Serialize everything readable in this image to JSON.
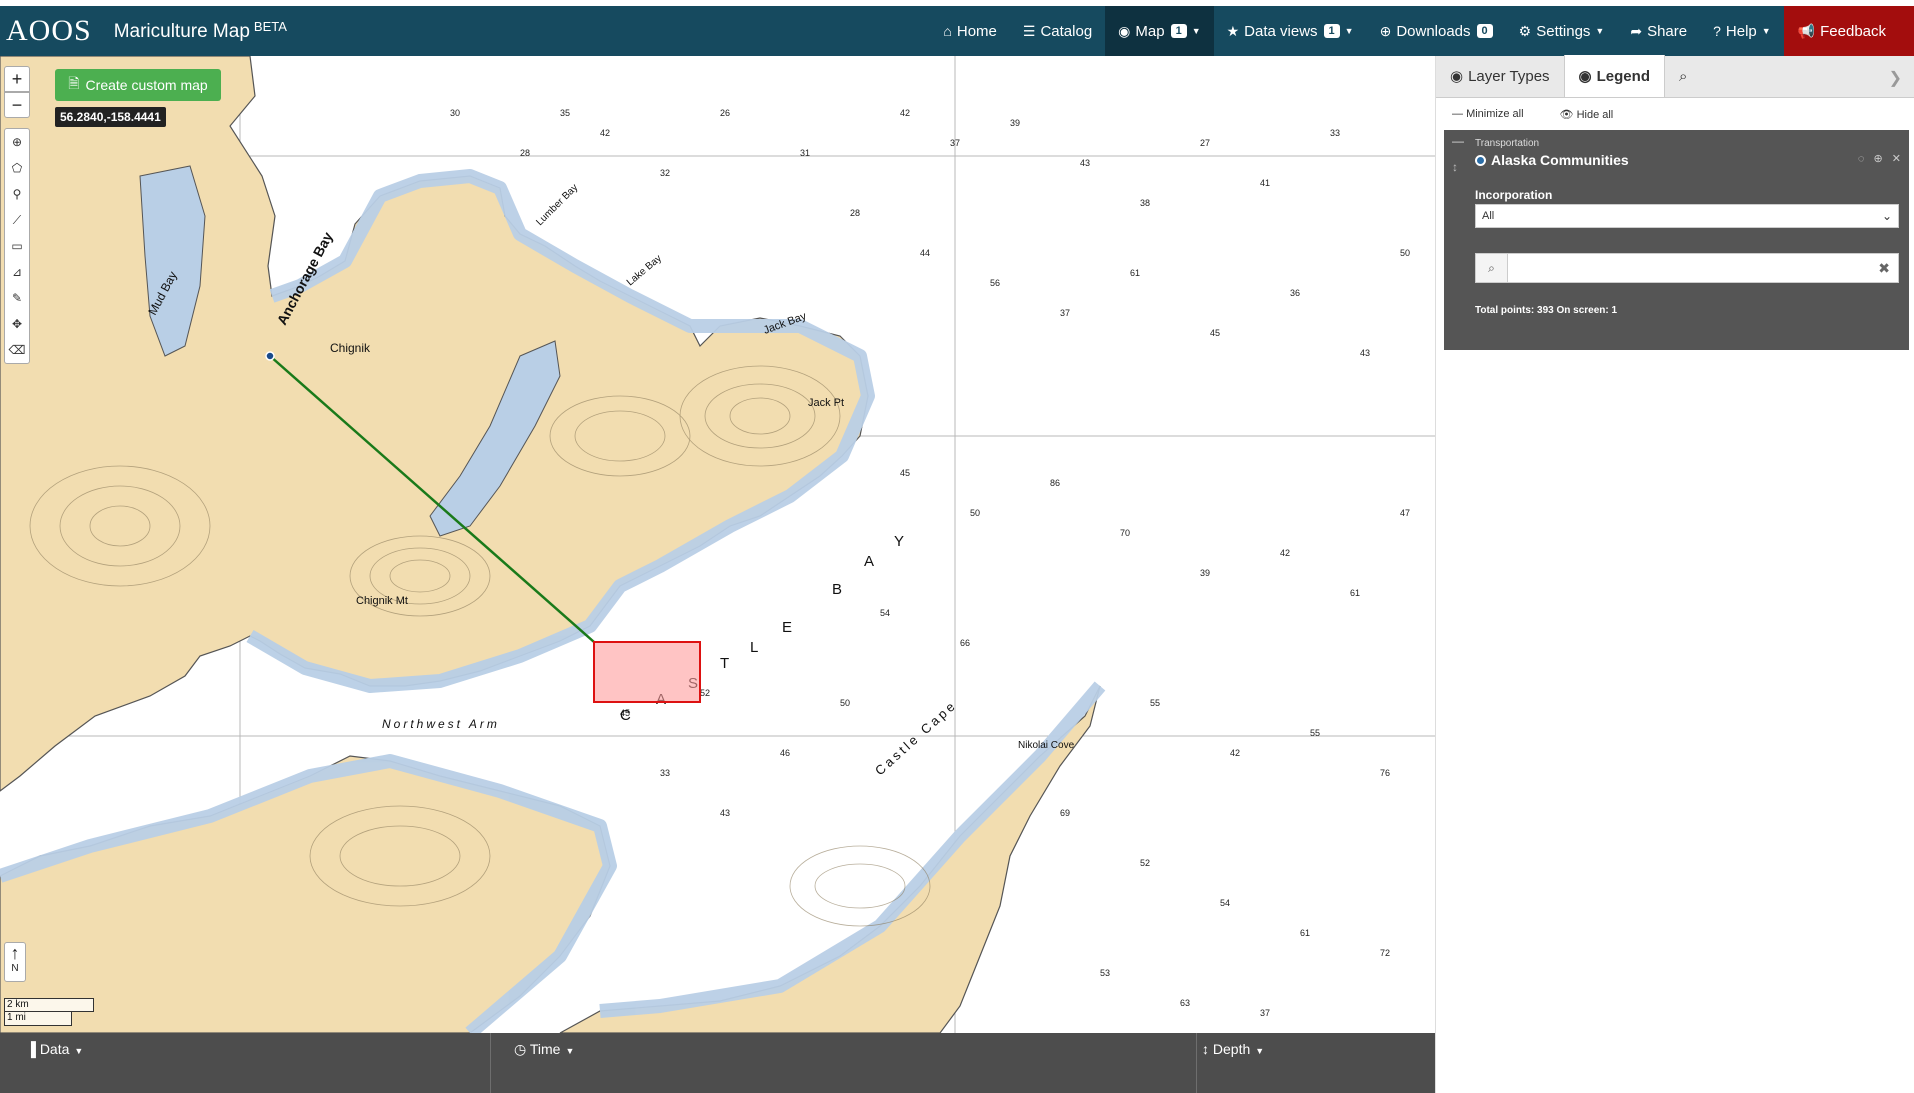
{
  "app": {
    "logo": "AOOS",
    "title": "Mariculture Map",
    "title_badge": "BETA"
  },
  "nav": {
    "home": "Home",
    "catalog": "Catalog",
    "map": "Map",
    "map_count": "1",
    "data_views": "Data views",
    "data_views_count": "1",
    "downloads": "Downloads",
    "downloads_count": "0",
    "settings": "Settings",
    "share": "Share",
    "help": "Help",
    "feedback": "Feedback"
  },
  "map": {
    "create_custom_map": "Create custom map",
    "coordinates": "56.2840,-158.4441",
    "north_label": "N",
    "scale_km": "2 km",
    "scale_mi": "1 mi",
    "chart_labels": {
      "anchorage_bay": "Anchorage Bay",
      "mud_bay": "Mud Bay",
      "chignik": "Chignik",
      "chignik_mt": "Chignik Mt",
      "jack_bay": "Jack Bay",
      "jack_pt": "Jack Pt",
      "lake_bay": "Lake Bay",
      "lumber_bay": "Lumber Bay",
      "northwest_arm": "Northwest Arm",
      "castle_cape": "Castle Cape",
      "nikolai_cove": "Nikolai Cove",
      "castle_bay_letters": [
        "C",
        "A",
        "S",
        "T",
        "L",
        "E",
        "B",
        "A",
        "Y"
      ]
    }
  },
  "bottom": {
    "data": "Data",
    "time": "Time",
    "depth": "Depth"
  },
  "sidebar": {
    "tabs": [
      "Layer Types",
      "Legend"
    ],
    "minimize_all": "Minimize all",
    "hide_all": "Hide all",
    "layer": {
      "category": "Transportation",
      "name": "Alaska Communities",
      "filter_label": "Incorporation",
      "filter_value": "All",
      "search_placeholder": "",
      "total": "Total points: 393 On screen: 1"
    }
  },
  "colors": {
    "navbar": "#164a5f",
    "feedback": "#a30d0d",
    "land": "#f2ddb0",
    "shallow_water": "#b9cfe6",
    "create_button": "#4caf50",
    "selection_box": "#ff9c9c"
  }
}
